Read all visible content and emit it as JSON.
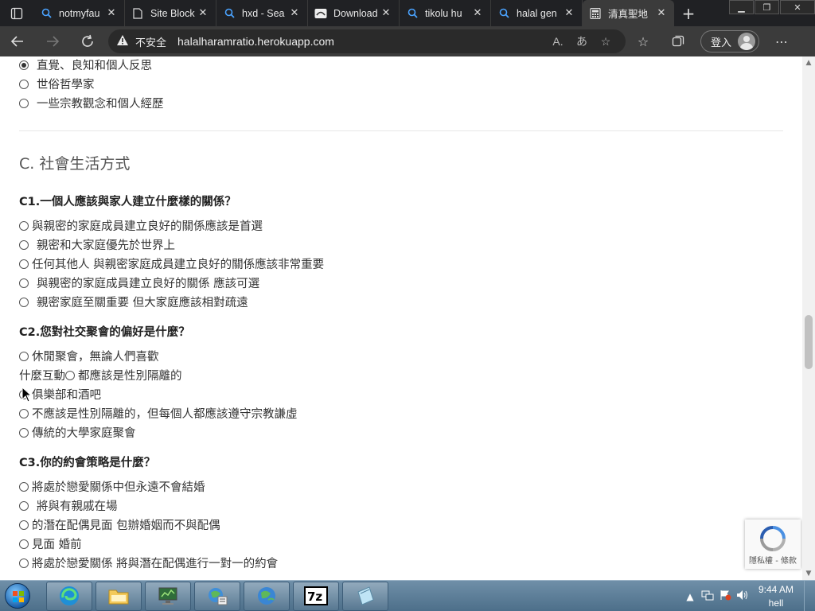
{
  "browser": {
    "tabs": [
      {
        "label": "notmyfau",
        "icon": "search-icon",
        "active": false
      },
      {
        "label": "Site Block",
        "icon": "page-icon",
        "active": false
      },
      {
        "label": "hxd - Sea",
        "icon": "search-icon",
        "active": false
      },
      {
        "label": "Download",
        "icon": "download-site-icon",
        "active": false
      },
      {
        "label": "tikolu hu",
        "icon": "search-icon",
        "active": false
      },
      {
        "label": "halal gen",
        "icon": "search-icon",
        "active": false
      },
      {
        "label": "清真聖地",
        "icon": "calculator-icon",
        "active": true
      }
    ],
    "address": {
      "security_label": "不安全",
      "url": "halalharamratio.herokuapp.com"
    },
    "signin_label": "登入"
  },
  "page": {
    "prev_options": [
      {
        "text": "直覺、良知和個人反思",
        "checked": true
      },
      {
        "text": "世俗哲學家",
        "checked": false
      },
      {
        "text": "一些宗教觀念和個人經歷",
        "checked": false
      }
    ],
    "section_title": "C. 社會生活方式",
    "q1": {
      "title": "C1.一個人應該與家人建立什麼樣的關係？",
      "options": [
        "與親密的家庭成員建立良好的關係應該是首選",
        "親密和大家庭優先於世界上",
        "任何其他人 與親密家庭成員建立良好的關係應該非常重要",
        "與親密的家庭成員建立良好的關係 應該可選",
        "親密家庭至關重要 但大家庭應該相對疏遠"
      ]
    },
    "q2": {
      "title": "C2.您對社交聚會的偏好是什麼？",
      "option1": "休閒聚會，無論人們喜歡",
      "line2_prefix": "什麼互動",
      "option2": "都應該是性別隔離的",
      "option3": "俱樂部和酒吧",
      "option4": "不應該是性別隔離的，但每個人都應該遵守宗教謙虛",
      "option5": "傳統的大學家庭聚會"
    },
    "q3": {
      "title": "C3.你的約會策略是什麼？",
      "options": [
        "將處於戀愛關係中但永遠不會結婚",
        "將與有親戚在場",
        "的潛在配偶見面 包辦婚姻而不與配偶",
        "見面 婚前",
        "將處於戀愛關係 將與潛在配偶進行一對一的約會"
      ]
    },
    "recaptcha_text": "隱私權 - 條款"
  },
  "taskbar": {
    "clock_time": "9:44 AM",
    "clock_label": "hell",
    "apps": [
      "edge-icon",
      "file-explorer-icon",
      "computer-monitor-icon",
      "network-globe-icon",
      "globe-icon",
      "7zip-icon",
      "notepad-icon"
    ]
  }
}
